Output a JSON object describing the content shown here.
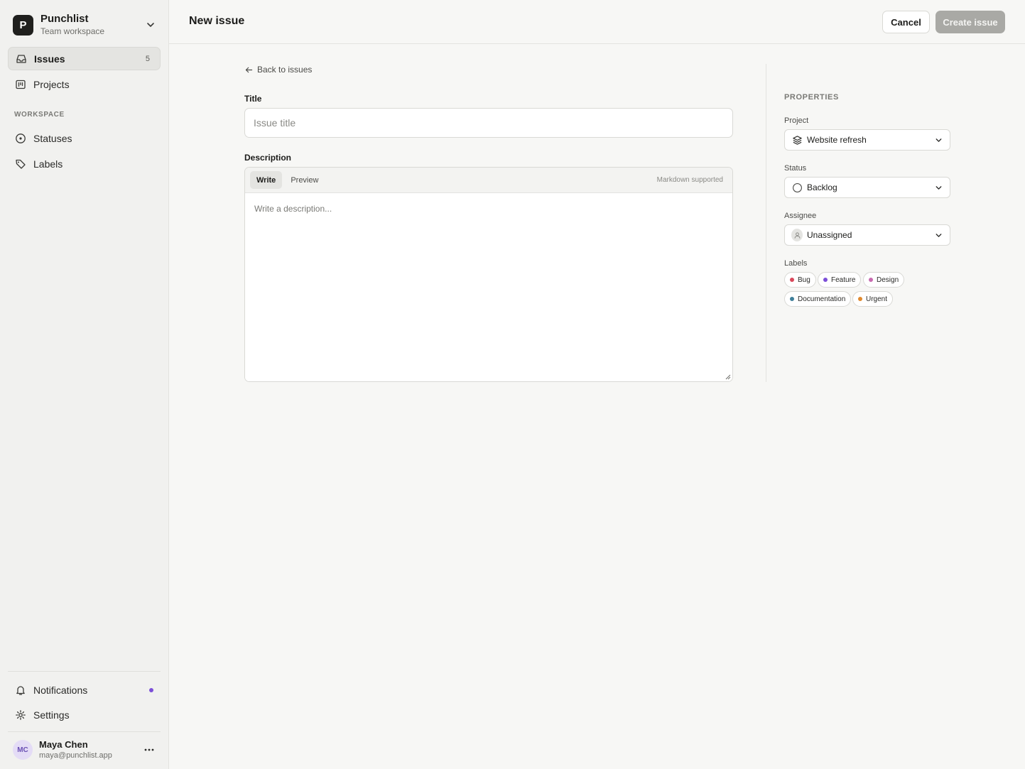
{
  "workspace": {
    "initial": "P",
    "name": "Punchlist",
    "subtitle": "Team workspace"
  },
  "nav": {
    "issues": {
      "label": "Issues",
      "count": "5"
    },
    "projects": {
      "label": "Projects"
    },
    "section_label": "WORKSPACE",
    "statuses": {
      "label": "Statuses"
    },
    "labels": {
      "label": "Labels"
    },
    "notifications": {
      "label": "Notifications"
    },
    "settings": {
      "label": "Settings"
    }
  },
  "user": {
    "initials": "MC",
    "name": "Maya Chen",
    "email": "maya@punchlist.app"
  },
  "header": {
    "title": "New issue",
    "cancel_label": "Cancel",
    "create_label": "Create issue"
  },
  "form": {
    "back_label": "Back to issues",
    "title_label": "Title",
    "title_placeholder": "Issue title",
    "title_value": "",
    "description_label": "Description",
    "tab_write": "Write",
    "tab_preview": "Preview",
    "markdown_note": "Markdown supported",
    "description_placeholder": "Write a description..."
  },
  "properties": {
    "heading": "PROPERTIES",
    "project_label": "Project",
    "project_value": "Website refresh",
    "status_label": "Status",
    "status_value": "Backlog",
    "assignee_label": "Assignee",
    "assignee_value": "Unassigned",
    "labels_label": "Labels",
    "labels": [
      {
        "name": "Bug",
        "color": "#d9475a"
      },
      {
        "name": "Feature",
        "color": "#7c4fd8"
      },
      {
        "name": "Design",
        "color": "#c86bb0"
      },
      {
        "name": "Documentation",
        "color": "#3f7f9a"
      },
      {
        "name": "Urgent",
        "color": "#e08a2e"
      }
    ]
  },
  "colors": {
    "notification_dot": "#7c4fd8",
    "create_button_disabled": "#a9a9a5"
  }
}
